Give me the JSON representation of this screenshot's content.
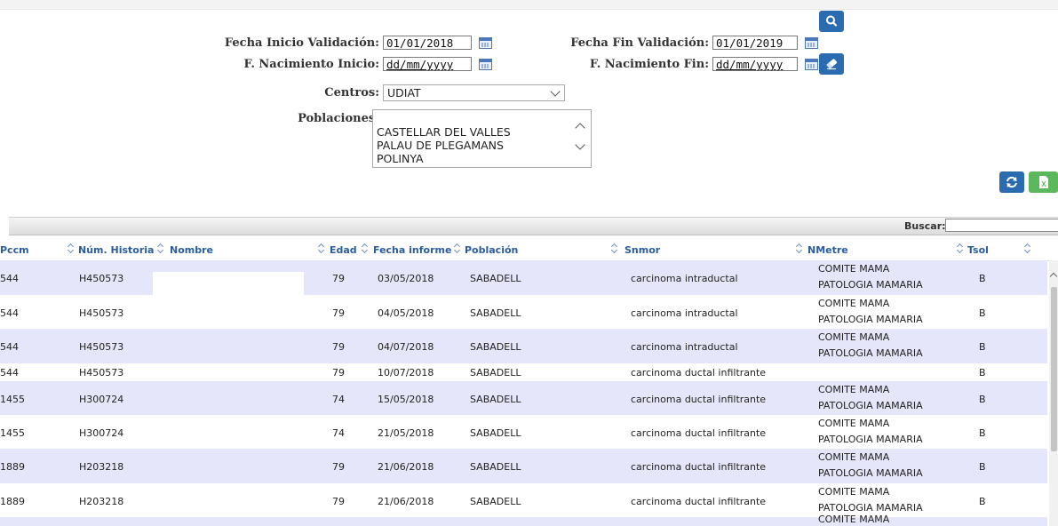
{
  "filters": {
    "fecha_inicio_label": "Fecha Inicio Validación:",
    "fecha_inicio_value": "01/01/2018",
    "fecha_fin_label": "Fecha Fin Validación:",
    "fecha_fin_value": "01/01/2019",
    "nac_inicio_label": "F. Nacimiento Inicio:",
    "nac_inicio_placeholder": "dd/mm/yyyy",
    "nac_fin_label": "F. Nacimiento Fin:",
    "nac_fin_placeholder": "dd/mm/yyyy",
    "centros_label": "Centros:",
    "centros_value": "UDIAT",
    "poblaciones_label": "Poblaciones:",
    "poblaciones_options": [
      "CASTELLAR DEL VALLES",
      "PALAU DE PLEGAMANS",
      "POLINYA"
    ]
  },
  "buttons": {
    "search_icon": "search-icon",
    "clear_icon": "eraser-icon",
    "refresh_icon": "refresh-icon",
    "excel_icon": "excel-icon",
    "excel_letter": "X"
  },
  "table": {
    "search_label": "Buscar:",
    "columns": [
      "Pccm",
      "Núm. Historia",
      "Nombre",
      "Edad",
      "Fecha informe",
      "Población",
      "Snmor",
      "NMetre",
      "Tsol"
    ],
    "rows": [
      {
        "pccm": "544",
        "historia": "H450573",
        "edad": "79",
        "fecha": "03/05/2018",
        "poblacion": "SABADELL",
        "snmor": "carcinoma intraductal",
        "nmetre": "COMITE MAMA PATOLOGIA MAMARIA",
        "tsol": "B"
      },
      {
        "pccm": "544",
        "historia": "H450573",
        "edad": "79",
        "fecha": "04/05/2018",
        "poblacion": "SABADELL",
        "snmor": "carcinoma intraductal",
        "nmetre": "COMITE MAMA PATOLOGIA MAMARIA",
        "tsol": "B"
      },
      {
        "pccm": "544",
        "historia": "H450573",
        "edad": "79",
        "fecha": "04/07/2018",
        "poblacion": "SABADELL",
        "snmor": "carcinoma intraductal",
        "nmetre": "COMITE MAMA PATOLOGIA MAMARIA",
        "tsol": "B"
      },
      {
        "pccm": "544",
        "historia": "H450573",
        "edad": "79",
        "fecha": "10/07/2018",
        "poblacion": "SABADELL",
        "snmor": "carcinoma ductal infiltrante",
        "nmetre": "",
        "tsol": "B"
      },
      {
        "pccm": "1455",
        "historia": "H300724",
        "edad": "74",
        "fecha": "15/05/2018",
        "poblacion": "SABADELL",
        "snmor": "carcinoma ductal infiltrante",
        "nmetre": "COMITE MAMA PATOLOGIA MAMARIA",
        "tsol": "B"
      },
      {
        "pccm": "1455",
        "historia": "H300724",
        "edad": "74",
        "fecha": "21/05/2018",
        "poblacion": "SABADELL",
        "snmor": "carcinoma ductal infiltrante",
        "nmetre": "COMITE MAMA PATOLOGIA MAMARIA",
        "tsol": "B"
      },
      {
        "pccm": "1889",
        "historia": "H203218",
        "edad": "79",
        "fecha": "21/06/2018",
        "poblacion": "SABADELL",
        "snmor": "carcinoma ductal infiltrante",
        "nmetre": "COMITE MAMA PATOLOGIA MAMARIA",
        "tsol": "B"
      },
      {
        "pccm": "1889",
        "historia": "H203218",
        "edad": "79",
        "fecha": "21/06/2018",
        "poblacion": "SABADELL",
        "snmor": "carcinoma ductal infiltrante",
        "nmetre": "COMITE MAMA PATOLOGIA MAMARIA",
        "tsol": "B"
      },
      {
        "pccm": "",
        "historia": "",
        "edad": "",
        "fecha": "",
        "poblacion": "",
        "snmor": "",
        "nmetre": "COMITE MAMA PATOLOGIA",
        "tsol": ""
      }
    ]
  },
  "colors": {
    "header_link": "#2a5d9c",
    "alt_row": "#e6e6fa",
    "primary_button": "#2b6cb0",
    "excel_button": "#5cb85c"
  }
}
